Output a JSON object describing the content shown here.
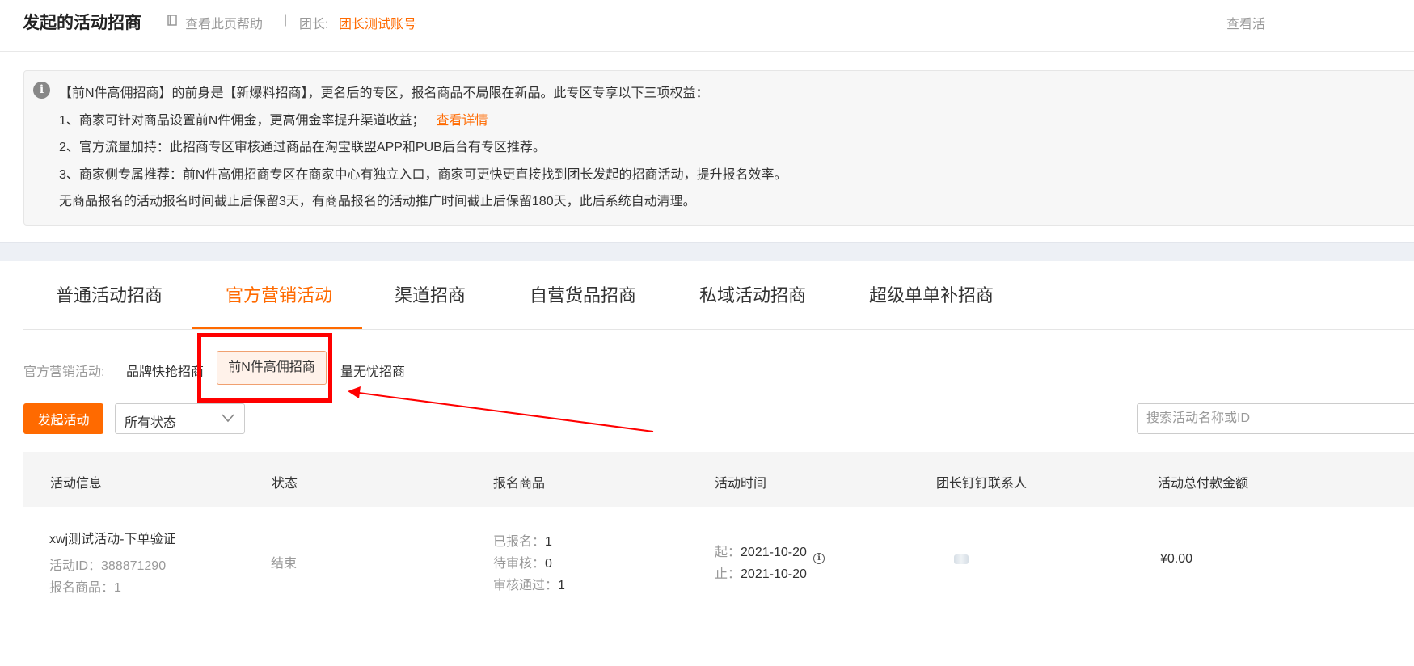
{
  "header": {
    "title": "发起的活动招商",
    "help_link": "查看此页帮助",
    "separator": "|",
    "leader_label": "团长:",
    "leader_name": "团长测试账号",
    "right_link": "查看活"
  },
  "notice": {
    "icon": "info-icon",
    "lines": [
      "【前N件高佣招商】的前身是【新爆料招商】，更名后的专区，报名商品不局限在新品。此专区专享以下三项权益：",
      "1、商家可针对商品设置前N件佣金，更高佣金率提升渠道收益；",
      "2、官方流量加持：此招商专区审核通过商品在淘宝联盟APP和PUB后台有专区推荐。",
      "3、商家侧专属推荐：前N件高佣招商专区在商家中心有独立入口，商家可更快更直接找到团长发起的招商活动，提升报名效率。",
      "无商品报名的活动报名时间截止后保留3天，有商品报名的活动推广时间截止后保留180天，此后系统自动清理。"
    ],
    "detail_link": "查看详情"
  },
  "tabs": [
    {
      "label": "普通活动招商"
    },
    {
      "label": "官方营销活动",
      "active": true
    },
    {
      "label": "渠道招商"
    },
    {
      "label": "自营货品招商"
    },
    {
      "label": "私域活动招商"
    },
    {
      "label": "超级单单补招商"
    }
  ],
  "subtabs": {
    "label": "官方营销活动:",
    "items": [
      {
        "label": "品牌快抢招商"
      },
      {
        "label": "前N件高佣招商",
        "active": true
      },
      {
        "label": "量无忧招商"
      }
    ]
  },
  "toolbar": {
    "launch_label": "发起活动",
    "status_select": "所有状态",
    "search_placeholder": "搜索活动名称或ID"
  },
  "table": {
    "headers": [
      "活动信息",
      "状态",
      "报名商品",
      "活动时间",
      "团长钉钉联系人",
      "活动总付款金额"
    ],
    "rows": [
      {
        "name": "xwj测试活动-下单验证",
        "id_label": "活动ID：",
        "id_value": "388871290",
        "goods_label": "报名商品：",
        "goods_value": "1",
        "status": "结束",
        "registered_label": "已报名：",
        "registered_value": "1",
        "pending_label": "待审核：",
        "pending_value": "0",
        "approved_label": "审核通过：",
        "approved_value": "1",
        "start_label": "起：",
        "start_date": "2021-10-20",
        "end_label": "止：",
        "end_date": "2021-10-20",
        "amount": "¥0.00"
      }
    ]
  },
  "annotation": {
    "highlight_color": "#ff0000",
    "accent_color": "#ff6a00"
  }
}
